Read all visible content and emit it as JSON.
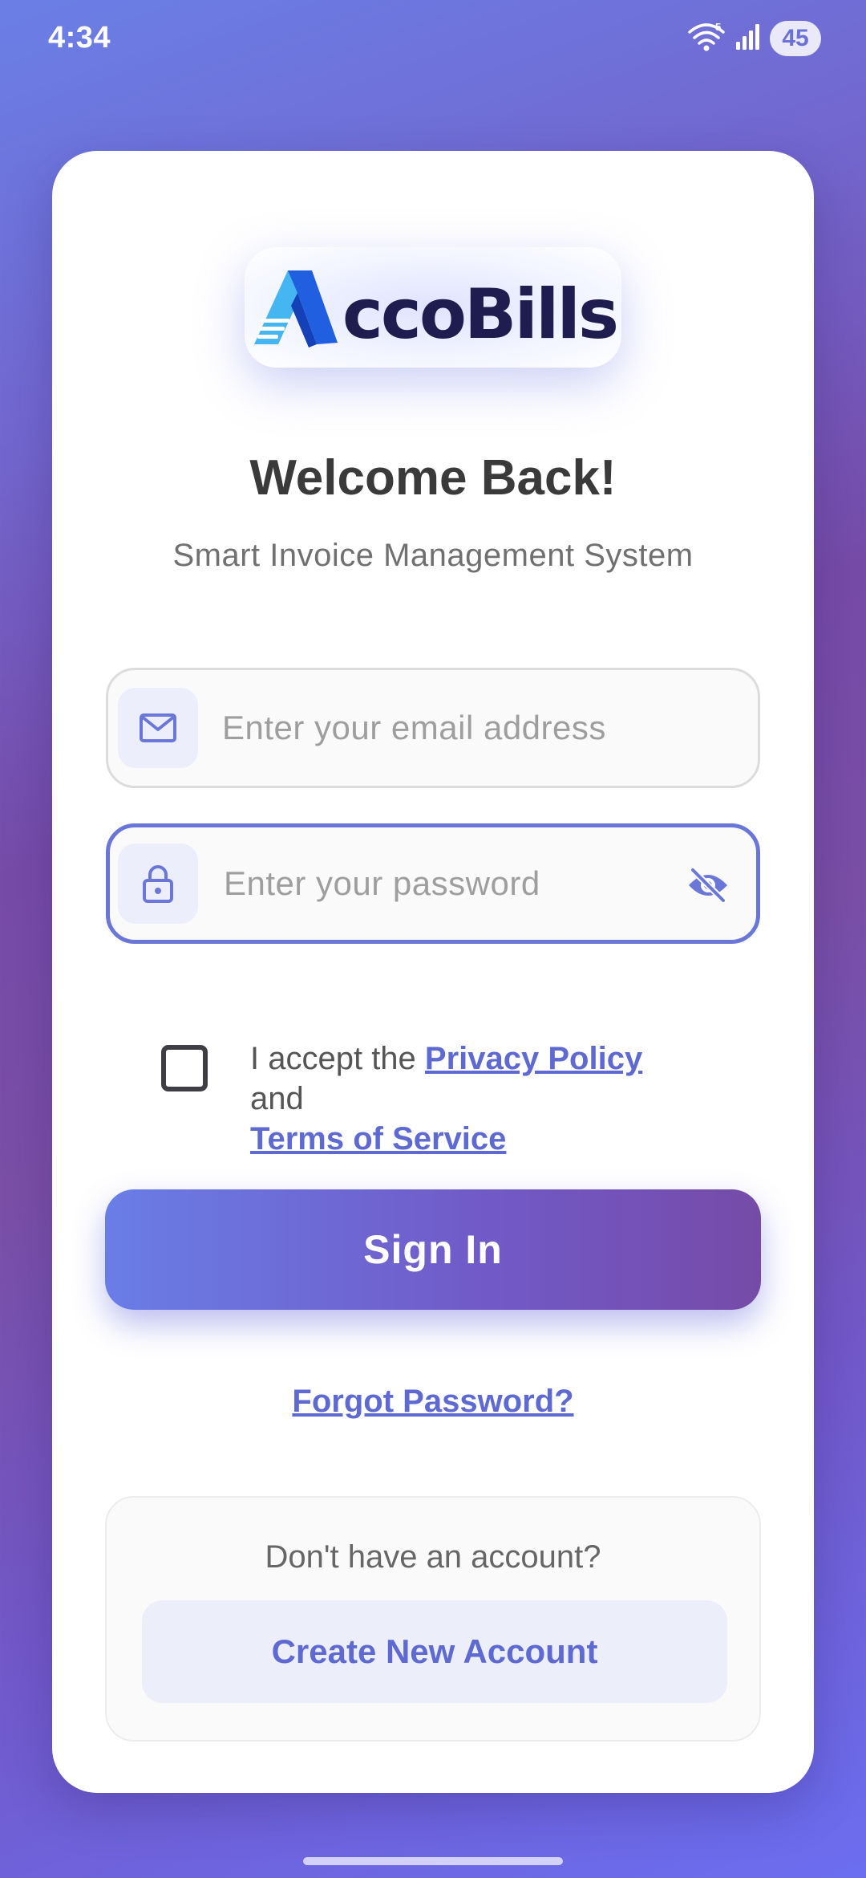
{
  "status_bar": {
    "time": "4:34",
    "battery": "45",
    "wifi_badge": "5",
    "icons": [
      "wifi-icon",
      "signal-icon",
      "battery-icon"
    ]
  },
  "logo": {
    "text": "ccoBills",
    "brand_color": "#1f1d4f",
    "accent": "#2f6be8"
  },
  "header": {
    "title": "Welcome Back!",
    "subtitle": "Smart Invoice Management System"
  },
  "form": {
    "email": {
      "placeholder": "Enter your email address",
      "value": "",
      "icon": "mail-icon"
    },
    "password": {
      "placeholder": "Enter your password",
      "value": "",
      "icon": "lock-icon",
      "toggle_icon": "eye-off-icon",
      "focused": true
    }
  },
  "consent": {
    "checked": false,
    "prefix": "I accept the",
    "privacy_link": "Privacy Policy",
    "conjunction": "and",
    "terms_link": "Terms of Service"
  },
  "actions": {
    "sign_in": "Sign In",
    "forgot_password": "Forgot Password?"
  },
  "signup": {
    "prompt": "Don't have an account?",
    "button": "Create New Account"
  },
  "colors": {
    "primary": "#6a77d8",
    "gradient_start": "#6a7de6",
    "gradient_end": "#764ba8",
    "link": "#5e6ad2"
  }
}
